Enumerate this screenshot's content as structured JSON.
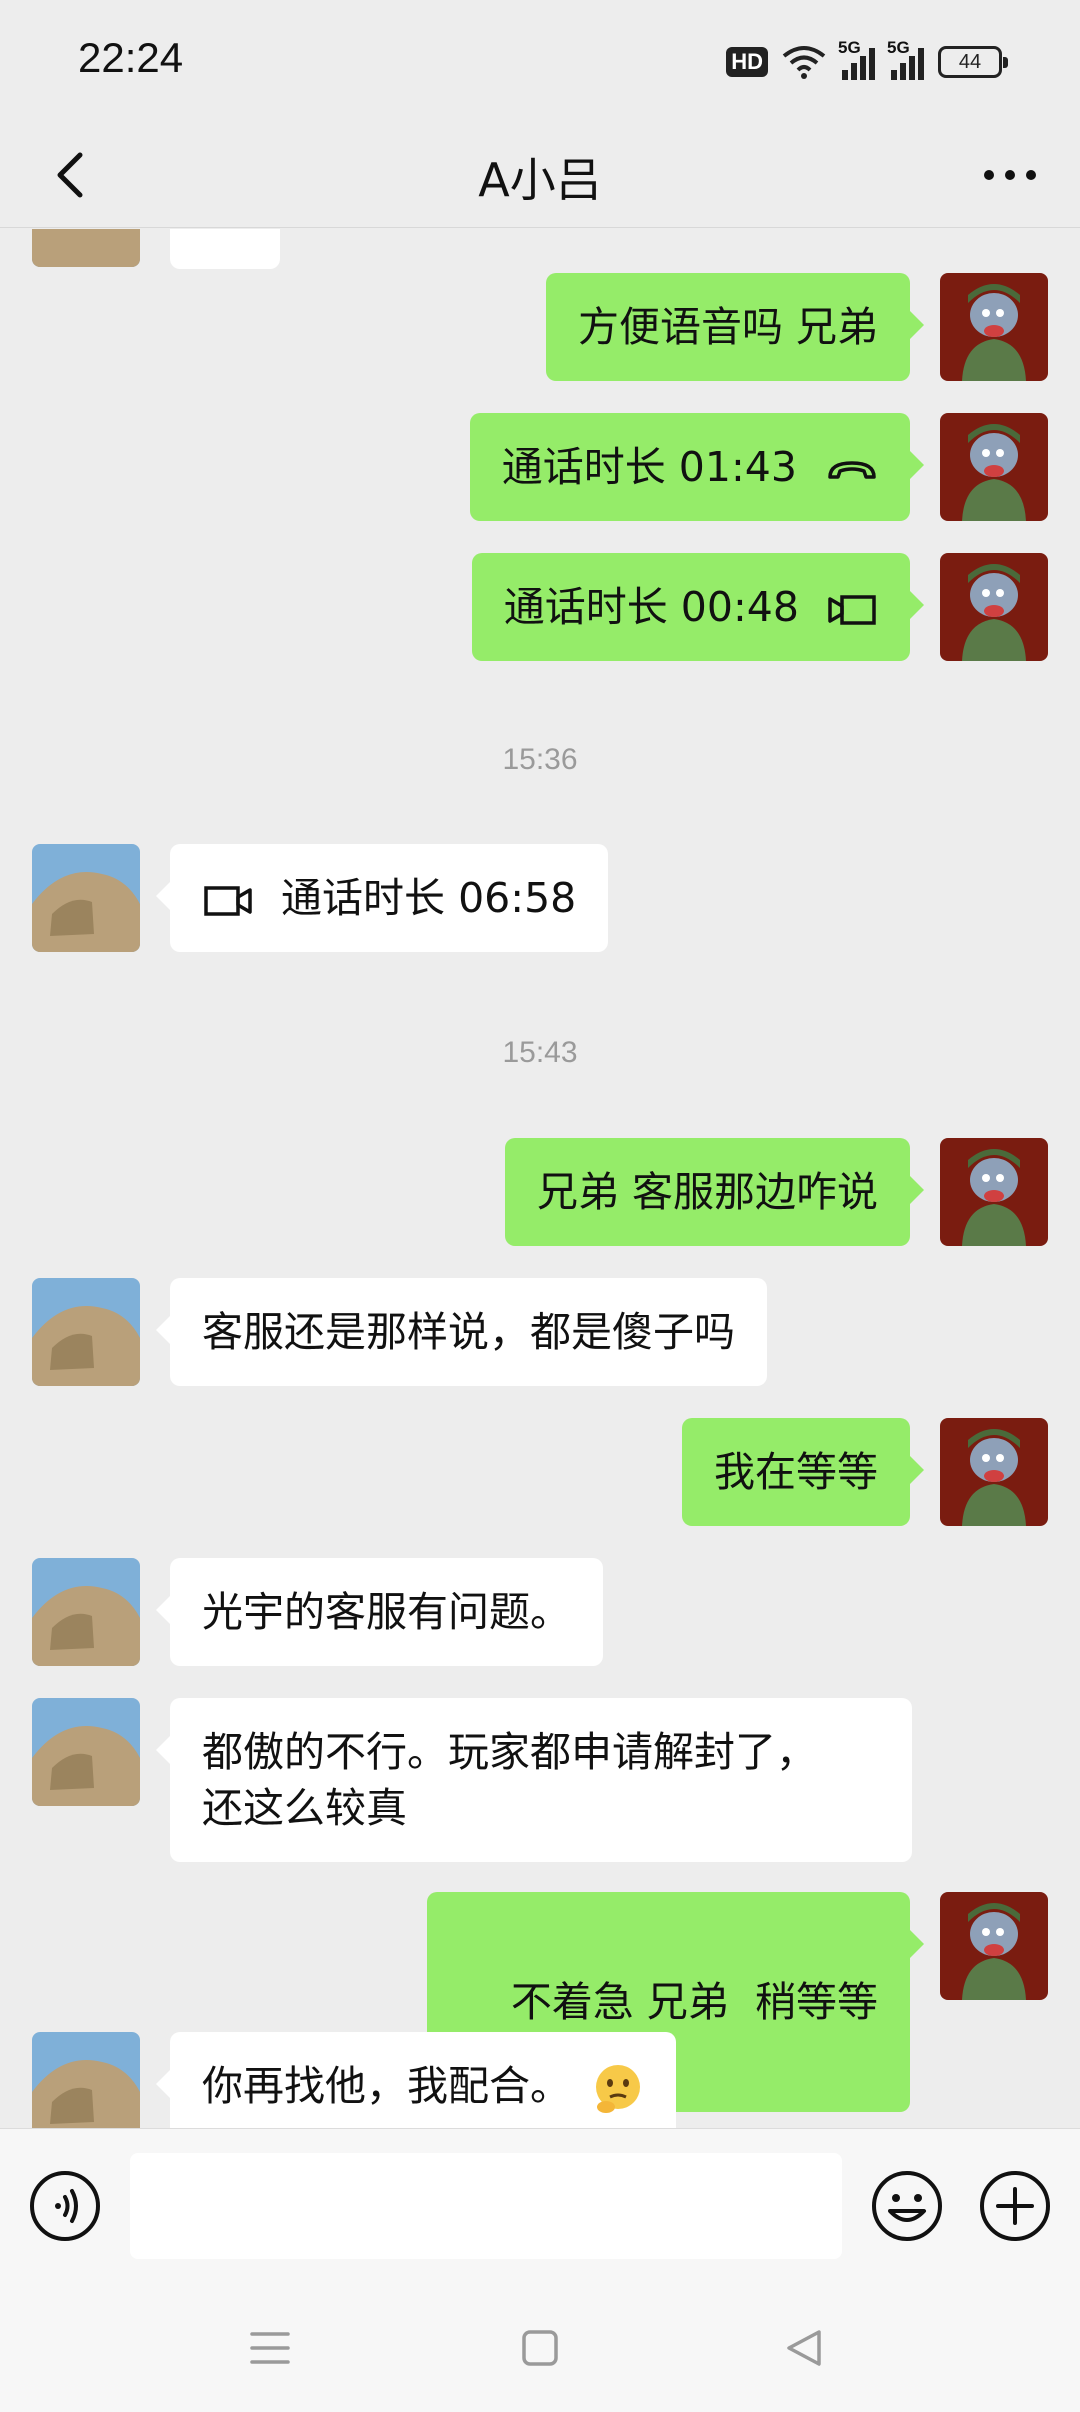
{
  "status_bar": {
    "time": "22:24",
    "hd_label": "HD",
    "network_1": "5G",
    "network_2": "5G",
    "battery_level": "44"
  },
  "header": {
    "title": "A小吕",
    "back_icon": "chevron-left-icon",
    "more_icon": "more-icon"
  },
  "colors": {
    "outgoing_bubble": "#95ec69",
    "incoming_bubble": "#ffffff",
    "background": "#ededed"
  },
  "messages": [
    {
      "direction": "out",
      "text": "方便语音吗 兄弟"
    },
    {
      "direction": "out",
      "text": "通话时长 01:43",
      "icon": "phone-hangup-icon"
    },
    {
      "direction": "out",
      "text": "通话时长 00:48",
      "icon": "video-call-icon"
    },
    {
      "type": "time",
      "text": "15:36"
    },
    {
      "direction": "in",
      "text": "通话时长 06:58",
      "icon": "video-call-icon"
    },
    {
      "type": "time",
      "text": "15:43"
    },
    {
      "direction": "out",
      "text": "兄弟 客服那边咋说"
    },
    {
      "direction": "in",
      "text": "客服还是那样说，都是傻子吗"
    },
    {
      "direction": "out",
      "text": "我在等等"
    },
    {
      "direction": "in",
      "text": "光宇的客服有问题。"
    },
    {
      "direction": "in",
      "text": "都傲的不行。玩家都申请解封了，"
    },
    {
      "direction": "in",
      "text": "还这么较真"
    },
    {
      "direction": "out",
      "text": "不着急 兄弟  稍等等"
    },
    {
      "direction": "in",
      "text": "你再找他，我配合。",
      "emoji": "thinking-face-emoji"
    }
  ],
  "input_bar": {
    "voice_icon": "voice-icon",
    "emoji_icon": "smiley-icon",
    "plus_icon": "plus-icon",
    "input_value": ""
  },
  "nav_bar": {
    "menu_icon": "menu-icon",
    "home_icon": "home-icon",
    "back_icon": "back-triangle-icon"
  }
}
